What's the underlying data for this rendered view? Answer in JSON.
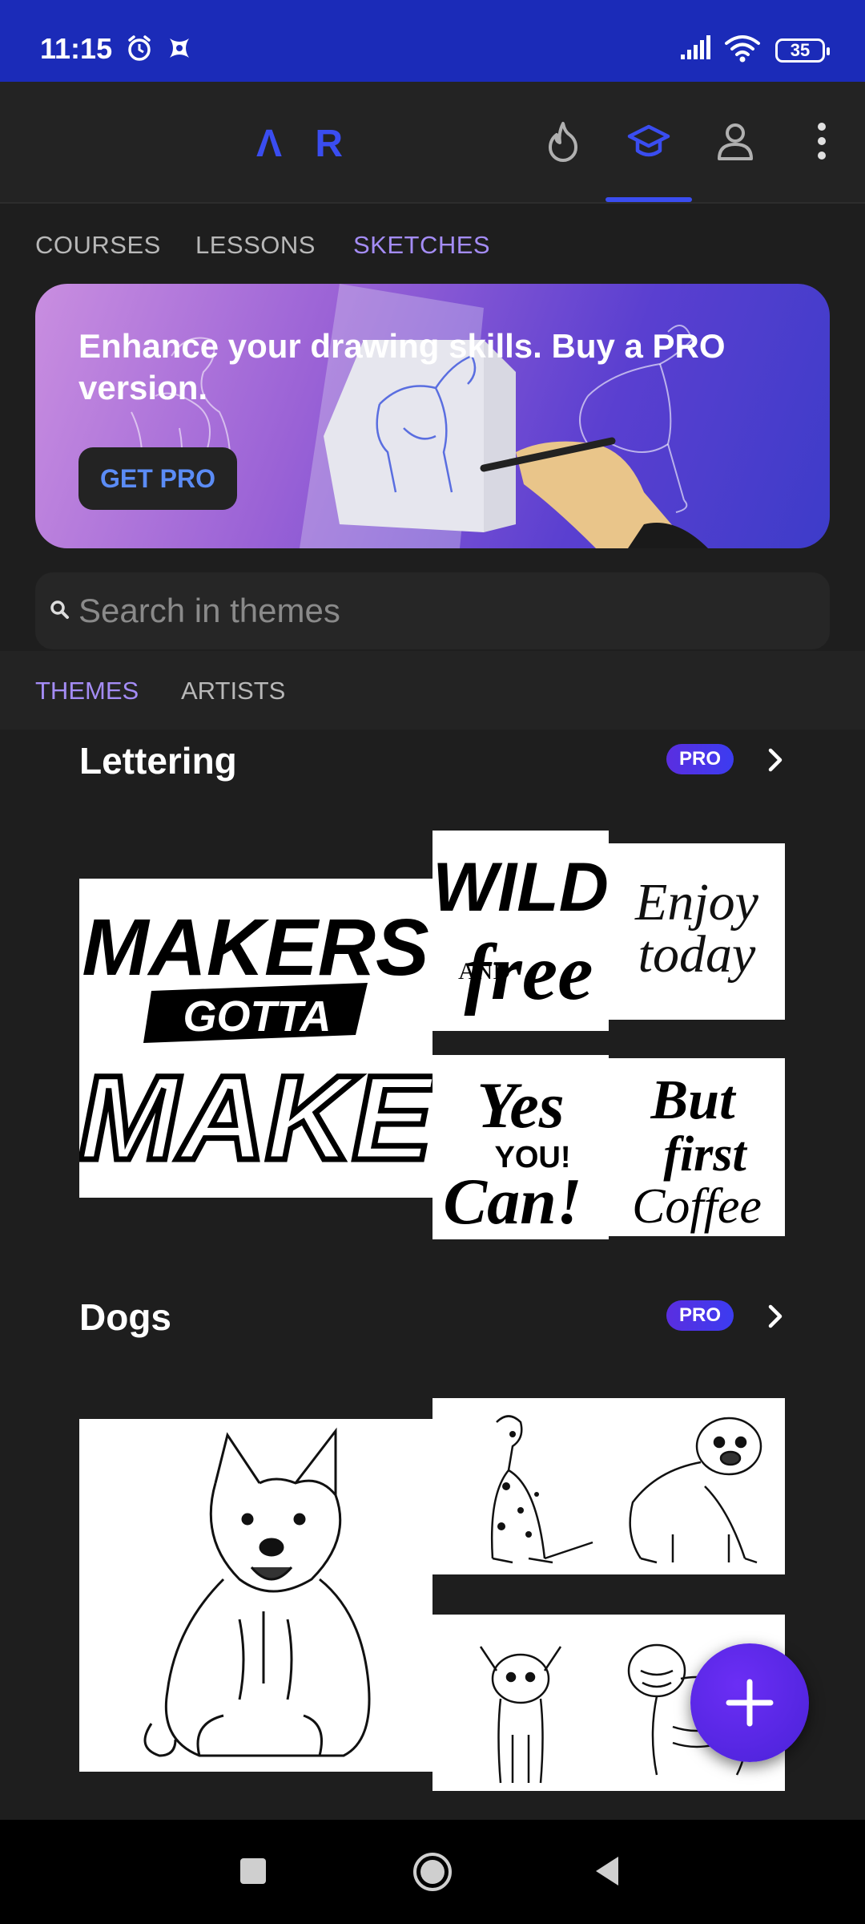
{
  "status": {
    "time": "11:15",
    "battery": "35"
  },
  "app_bar": {
    "logo": "Λ R",
    "icons": [
      "streak-icon",
      "courses-cap-icon",
      "profile-icon",
      "more-icon"
    ]
  },
  "main_tabs": [
    {
      "label": "COURSES",
      "active": false
    },
    {
      "label": "LESSONS",
      "active": false
    },
    {
      "label": "SKETCHES",
      "active": true
    }
  ],
  "banner": {
    "title": "Enhance your drawing skills. Buy a PRO version.",
    "button_label": "GET PRO"
  },
  "search": {
    "placeholder": "Search in themes"
  },
  "sub_tabs": [
    {
      "label": "THEMES",
      "active": true
    },
    {
      "label": "ARTISTS",
      "active": false
    }
  ],
  "sections": [
    {
      "title": "Lettering",
      "badge": "PRO",
      "tiles": [
        "MAKERS GOTTA MAKE",
        "WILD AND free",
        "Enjoy today",
        "Yes YOU Can!",
        "But first Coffee"
      ]
    },
    {
      "title": "Dogs",
      "badge": "PRO",
      "tiles": [
        "corgi",
        "dalmatian",
        "pug",
        "chihuahua",
        "shar-pei"
      ]
    }
  ],
  "colors": {
    "accent": "#3a4df0",
    "active_tab": "#a48cf5",
    "status_bar": "#1b2bb8",
    "background": "#1e1e1e"
  }
}
